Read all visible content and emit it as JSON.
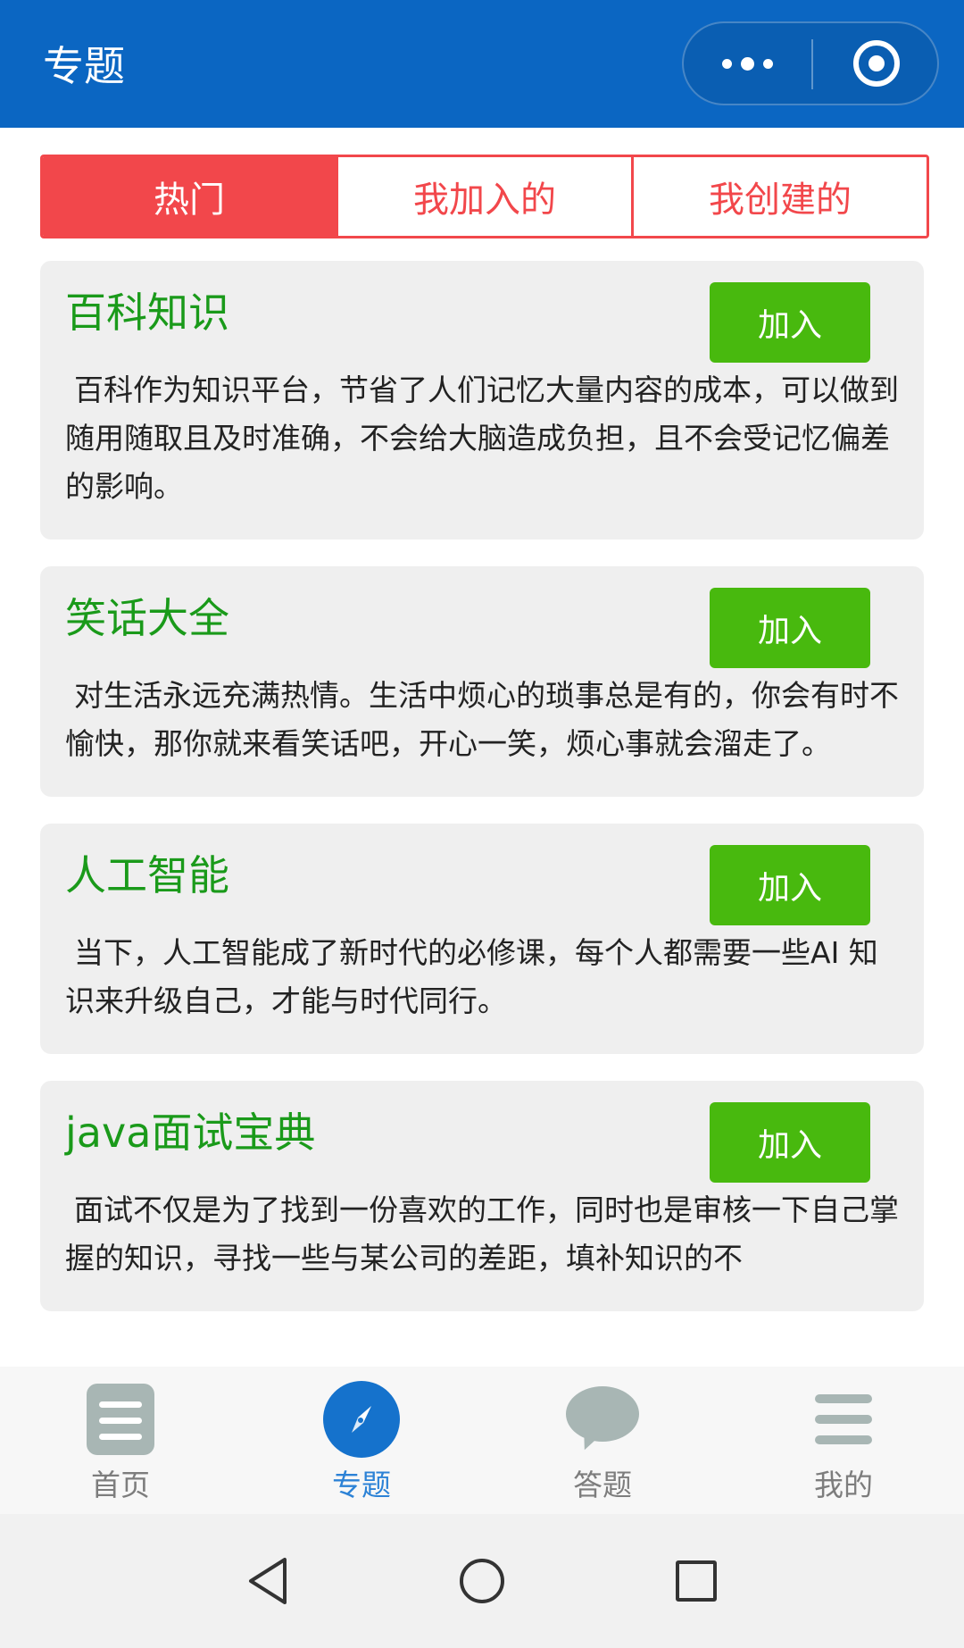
{
  "header": {
    "title": "专题",
    "more_icon": "more-dots-icon",
    "target_icon": "target-icon"
  },
  "tabs": [
    {
      "label": "热门",
      "active": true
    },
    {
      "label": "我加入的",
      "active": false
    },
    {
      "label": "我创建的",
      "active": false
    }
  ],
  "cards": [
    {
      "title": "百科知识",
      "button": "加入",
      "description": "百科作为知识平台，节省了人们记忆大量内容的成本，可以做到随用随取且及时准确，不会给大脑造成负担，且不会受记忆偏差的影响。"
    },
    {
      "title": "笑话大全",
      "button": "加入",
      "description": "对生活永远充满热情。生活中烦心的琐事总是有的，你会有时不愉快，那你就来看笑话吧，开心一笑，烦心事就会溜走了。"
    },
    {
      "title": "人工智能",
      "button": "加入",
      "description": "当下，人工智能成了新时代的必修课，每个人都需要一些AI 知识来升级自己，才能与时代同行。"
    },
    {
      "title": "java面试宝典",
      "button": "加入",
      "description": "面试不仅是为了找到一份喜欢的工作，同时也是审核一下自己掌握的知识，寻找一些与某公司的差距，填补知识的不"
    }
  ],
  "tabbar": [
    {
      "label": "首页",
      "icon": "home-document-icon",
      "active": false
    },
    {
      "label": "专题",
      "icon": "compass-icon",
      "active": true
    },
    {
      "label": "答题",
      "icon": "chat-bubble-icon",
      "active": false
    },
    {
      "label": "我的",
      "icon": "menu-icon",
      "active": false
    }
  ],
  "colors": {
    "header_bg": "#0b66c2",
    "tab_accent": "#f2474b",
    "card_title": "#1a9a1a",
    "join_button": "#48b90e",
    "tabbar_active": "#2c82d6",
    "tabbar_inactive": "#a8b6b4"
  }
}
